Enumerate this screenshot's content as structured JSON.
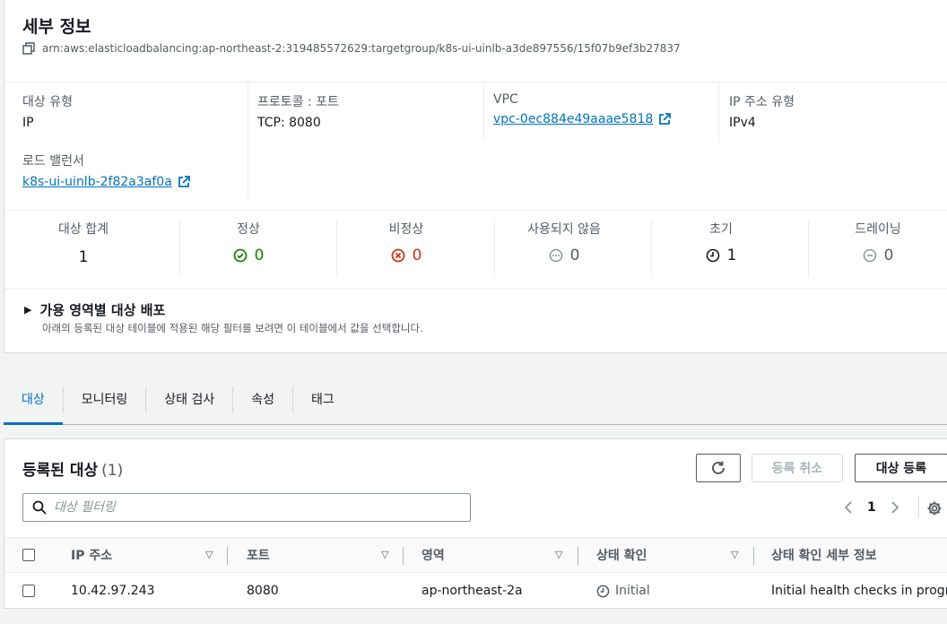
{
  "details": {
    "title": "세부 정보",
    "arn": "arn:aws:elasticloadbalancing:ap-northeast-2:319485572629:targetgroup/k8s-ui-uinlb-a3de897556/15f07b9ef3b27837",
    "target_type_label": "대상 유형",
    "target_type_value": "IP",
    "protocol_label": "프로토콜 : 포트",
    "protocol_value": "TCP: 8080",
    "vpc_label": "VPC",
    "vpc_value": "vpc-0ec884e49aaae5818",
    "ip_type_label": "IP 주소 유형",
    "ip_type_value": "IPv4",
    "lb_label": "로드 밸런서",
    "lb_value": "k8s-ui-uinlb-2f82a3af0a"
  },
  "stats": {
    "total_label": "대상 합계",
    "total_value": "1",
    "healthy_label": "정상",
    "healthy_value": "0",
    "unhealthy_label": "비정상",
    "unhealthy_value": "0",
    "unused_label": "사용되지 않음",
    "unused_value": "0",
    "initial_label": "초기",
    "initial_value": "1",
    "draining_label": "드레이닝",
    "draining_value": "0"
  },
  "az_section": {
    "title": "가용 영역별 대상 배포",
    "description": "아래의 등록된 대상 테이블에 적용된 해당 필터를 보려면 이 테이블에서 값을 선택합니다."
  },
  "tabs": [
    {
      "label": "대상"
    },
    {
      "label": "모니터링"
    },
    {
      "label": "상태 검사"
    },
    {
      "label": "속성"
    },
    {
      "label": "태그"
    }
  ],
  "targets": {
    "title": "등록된 대상",
    "count": "(1)",
    "deregister_label": "등록 취소",
    "register_label": "대상 등록",
    "search_placeholder": "대상 필터링",
    "page": "1",
    "columns": [
      "IP 주소",
      "포트",
      "영역",
      "상태 확인",
      "상태 확인 세부 정보"
    ],
    "rows": [
      {
        "ip": "10.42.97.243",
        "port": "8080",
        "zone": "ap-northeast-2a",
        "status": "Initial",
        "details": "Initial health checks in progr..."
      }
    ]
  },
  "colors": {
    "accent": "#0073bb",
    "healthy": "#1d8102",
    "unhealthy": "#d13212",
    "neutral": "#687078"
  }
}
